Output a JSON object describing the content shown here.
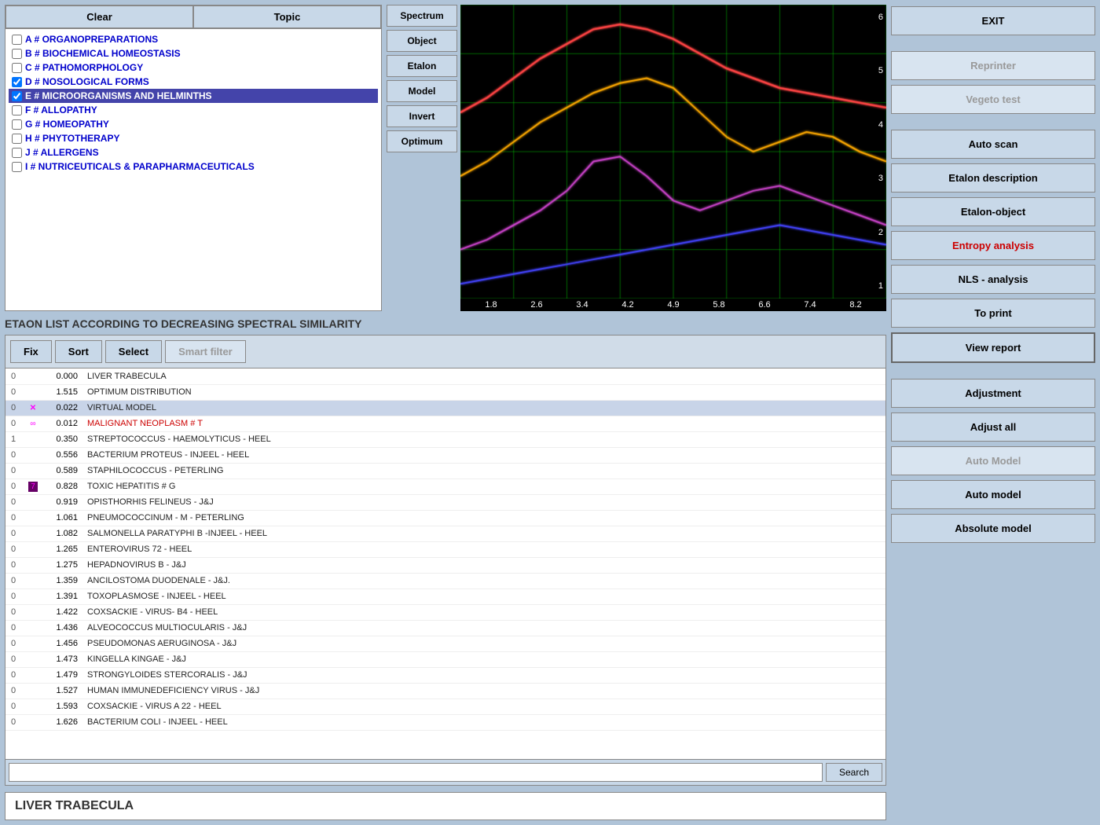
{
  "header": {
    "clear_label": "Clear",
    "topic_label": "Topic"
  },
  "spectrum_controls": {
    "spectrum_label": "Spectrum",
    "object_label": "Object",
    "etalon_label": "Etalon",
    "model_label": "Model",
    "invert_label": "Invert",
    "optimum_label": "Optimum"
  },
  "topic_items": [
    {
      "id": "A",
      "label": "A # ORGANOPREPARATIONS",
      "checked": false,
      "selected": false
    },
    {
      "id": "B",
      "label": "B # BIOCHEMICAL HOMEOSTASIS",
      "checked": false,
      "selected": false
    },
    {
      "id": "C",
      "label": "C # PATHOMORPHOLOGY",
      "checked": false,
      "selected": false
    },
    {
      "id": "D",
      "label": "D # NOSOLOGICAL  FORMS",
      "checked": true,
      "selected": false
    },
    {
      "id": "E",
      "label": "E # MICROORGANISMS AND HELMINTHS",
      "checked": true,
      "selected": true
    },
    {
      "id": "F",
      "label": "F # ALLOPATHY",
      "checked": false,
      "selected": false
    },
    {
      "id": "G",
      "label": "G # HOMEOPATHY",
      "checked": false,
      "selected": false
    },
    {
      "id": "H",
      "label": "H # PHYTOTHERAPY",
      "checked": false,
      "selected": false
    },
    {
      "id": "J",
      "label": "J # ALLERGENS",
      "checked": false,
      "selected": false
    },
    {
      "id": "I",
      "label": "I # NUTRICEUTICALS & PARAPHARMACEUTICALS",
      "checked": false,
      "selected": false
    }
  ],
  "chart": {
    "x_labels": [
      "1.8",
      "2.6",
      "3.4",
      "4.2",
      "4.9",
      "5.8",
      "6.6",
      "7.4",
      "8.2"
    ],
    "y_labels": [
      "6",
      "5",
      "4",
      "3",
      "2",
      "1"
    ]
  },
  "etaon": {
    "title": "ETAON LIST ACCORDING TO DECREASING SPECTRAL SIMILARITY",
    "fix_label": "Fix",
    "sort_label": "Sort",
    "select_label": "Select",
    "smart_filter_label": "Smart filter",
    "search_placeholder": "",
    "search_label": "Search",
    "selected_item_label": "LIVER  TRABECULA",
    "rows": [
      {
        "num": "0",
        "mark": "",
        "score": "0.000",
        "name": "LIVER  TRABECULA",
        "special": false,
        "red": false
      },
      {
        "num": "0",
        "mark": "",
        "score": "1.515",
        "name": "OPTIMUM DISTRIBUTION",
        "special": false,
        "red": false
      },
      {
        "num": "0",
        "mark": "✕",
        "score": "0.022",
        "name": "VIRTUAL MODEL",
        "special": true,
        "red": false
      },
      {
        "num": "0",
        "mark": "∞",
        "score": "0.012",
        "name": "MALIGNANT NEOPLASM  # T",
        "special": false,
        "red": true
      },
      {
        "num": "1",
        "mark": "",
        "score": "0.350",
        "name": "STREPTOCOCCUS - HAEMOLYTICUS  -  HEEL",
        "special": false,
        "red": false
      },
      {
        "num": "0",
        "mark": "",
        "score": "0.556",
        "name": "BACTERIUM  PROTEUS - INJEEL  -  HEEL",
        "special": false,
        "red": false
      },
      {
        "num": "0",
        "mark": "",
        "score": "0.589",
        "name": "STAPHILOCOCCUS  -  PETERLING",
        "special": false,
        "red": false
      },
      {
        "num": "0",
        "mark": "7",
        "score": "0.828",
        "name": "TOXIC  HEPATITIS   # G",
        "special": false,
        "red": false
      },
      {
        "num": "0",
        "mark": "",
        "score": "0.919",
        "name": "OPISTHORHIS FELINEUS  -  J&J",
        "special": false,
        "red": false
      },
      {
        "num": "0",
        "mark": "",
        "score": "1.061",
        "name": "PNEUMOCOCCINUM - M -  PETERLING",
        "special": false,
        "red": false
      },
      {
        "num": "0",
        "mark": "",
        "score": "1.082",
        "name": "SALMONELLA  PARATYPHI  B -INJEEL  -  HEEL",
        "special": false,
        "red": false
      },
      {
        "num": "0",
        "mark": "",
        "score": "1.265",
        "name": "ENTEROVIRUS  72  -  HEEL",
        "special": false,
        "red": false
      },
      {
        "num": "0",
        "mark": "",
        "score": "1.275",
        "name": "HEPADNOVIRUS  B  -  J&J",
        "special": false,
        "red": false
      },
      {
        "num": "0",
        "mark": "",
        "score": "1.359",
        "name": "ANCILOSTOMA  DUODENALE  - J&J.",
        "special": false,
        "red": false
      },
      {
        "num": "0",
        "mark": "",
        "score": "1.391",
        "name": "TOXOPLASMOSE - INJEEL  -  HEEL",
        "special": false,
        "red": false
      },
      {
        "num": "0",
        "mark": "",
        "score": "1.422",
        "name": "COXSACKIE - VIRUS- B4  -  HEEL",
        "special": false,
        "red": false
      },
      {
        "num": "0",
        "mark": "",
        "score": "1.436",
        "name": "ALVEOCOCCUS  MULTIOCULARIS  -  J&J",
        "special": false,
        "red": false
      },
      {
        "num": "0",
        "mark": "",
        "score": "1.456",
        "name": "PSEUDOMONAS  AERUGINOSA  - J&J",
        "special": false,
        "red": false
      },
      {
        "num": "0",
        "mark": "",
        "score": "1.473",
        "name": "KINGELLA  KINGAE  -  J&J",
        "special": false,
        "red": false
      },
      {
        "num": "0",
        "mark": "",
        "score": "1.479",
        "name": "STRONGYLOIDES  STERCORALIS  -  J&J",
        "special": false,
        "red": false
      },
      {
        "num": "0",
        "mark": "",
        "score": "1.527",
        "name": "HUMAN  IMMUNEDEFICIENCY  VIRUS  - J&J",
        "special": false,
        "red": false
      },
      {
        "num": "0",
        "mark": "",
        "score": "1.593",
        "name": "COXSACKIE - VIRUS  A 22  -  HEEL",
        "special": false,
        "red": false
      },
      {
        "num": "0",
        "mark": "",
        "score": "1.626",
        "name": "BACTERIUM  COLI - INJEEL  -  HEEL",
        "special": false,
        "red": false
      }
    ]
  },
  "sidebar": {
    "exit_label": "EXIT",
    "reprinter_label": "Reprinter",
    "vegeto_test_label": "Vegeto test",
    "auto_scan_label": "Auto scan",
    "etalon_description_label": "Etalon description",
    "etalon_object_label": "Etalon-object",
    "entropy_analysis_label": "Entropy analysis",
    "nls_analysis_label": "NLS - analysis",
    "to_print_label": "To print",
    "view_report_label": "View report",
    "adjustment_label": "Adjustment",
    "adjust_all_label": "Adjust all",
    "auto_model_label": "Auto Model",
    "auto_model2_label": "Auto model",
    "absolute_model_label": "Absolute model"
  }
}
